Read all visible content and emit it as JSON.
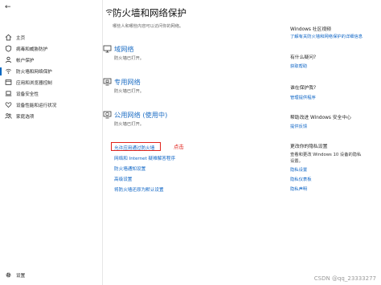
{
  "nav": {
    "back": "←",
    "items": [
      {
        "label": "主页"
      },
      {
        "label": "病毒和威胁防护"
      },
      {
        "label": "帐户保护"
      },
      {
        "label": "防火墙和网络保护"
      },
      {
        "label": "应用和浏览器控制"
      },
      {
        "label": "设备安全性"
      },
      {
        "label": "设备性能和运行状况"
      },
      {
        "label": "家庭选项"
      }
    ],
    "settings": "设置"
  },
  "page": {
    "title": "防火墙和网络保护",
    "subtitle": "哪些人和哪些内容可以访问你的网络。"
  },
  "networks": [
    {
      "name": "域网络",
      "status": "防火墙已打开。"
    },
    {
      "name": "专用网络",
      "status": "防火墙已打开。"
    },
    {
      "name": "公用网络 (使用中)",
      "status": "防火墙已打开。"
    }
  ],
  "links": [
    "允许应用通过防火墙",
    "网络和 Internet 疑难解答程序",
    "防火墙通知设置",
    "高级设置",
    "将防火墙还原为默认设置"
  ],
  "annotation": "点击",
  "right": {
    "community": {
      "title": "Windows 社区视频",
      "link": "了解有关防火墙和网络保护的详细信息"
    },
    "help": {
      "title": "有什么疑问?",
      "link": "获取帮助"
    },
    "who": {
      "title": "谁在保护我?",
      "link": "管理提供程序"
    },
    "improve": {
      "title": "帮助改进 Windows 安全中心",
      "link": "提供反馈"
    },
    "privacy": {
      "title": "更改你的隐私设置",
      "text": [
        "查看和更改 Windows 10 设备的隐私",
        "设置。"
      ],
      "links": [
        "隐私设置",
        "隐私仪表板",
        "隐私声明"
      ]
    }
  },
  "watermark": "CSDN @qq_23333277",
  "colors": {
    "link": "#0b63c5",
    "accent": "#0067c0",
    "highlight": "#e0221b"
  }
}
